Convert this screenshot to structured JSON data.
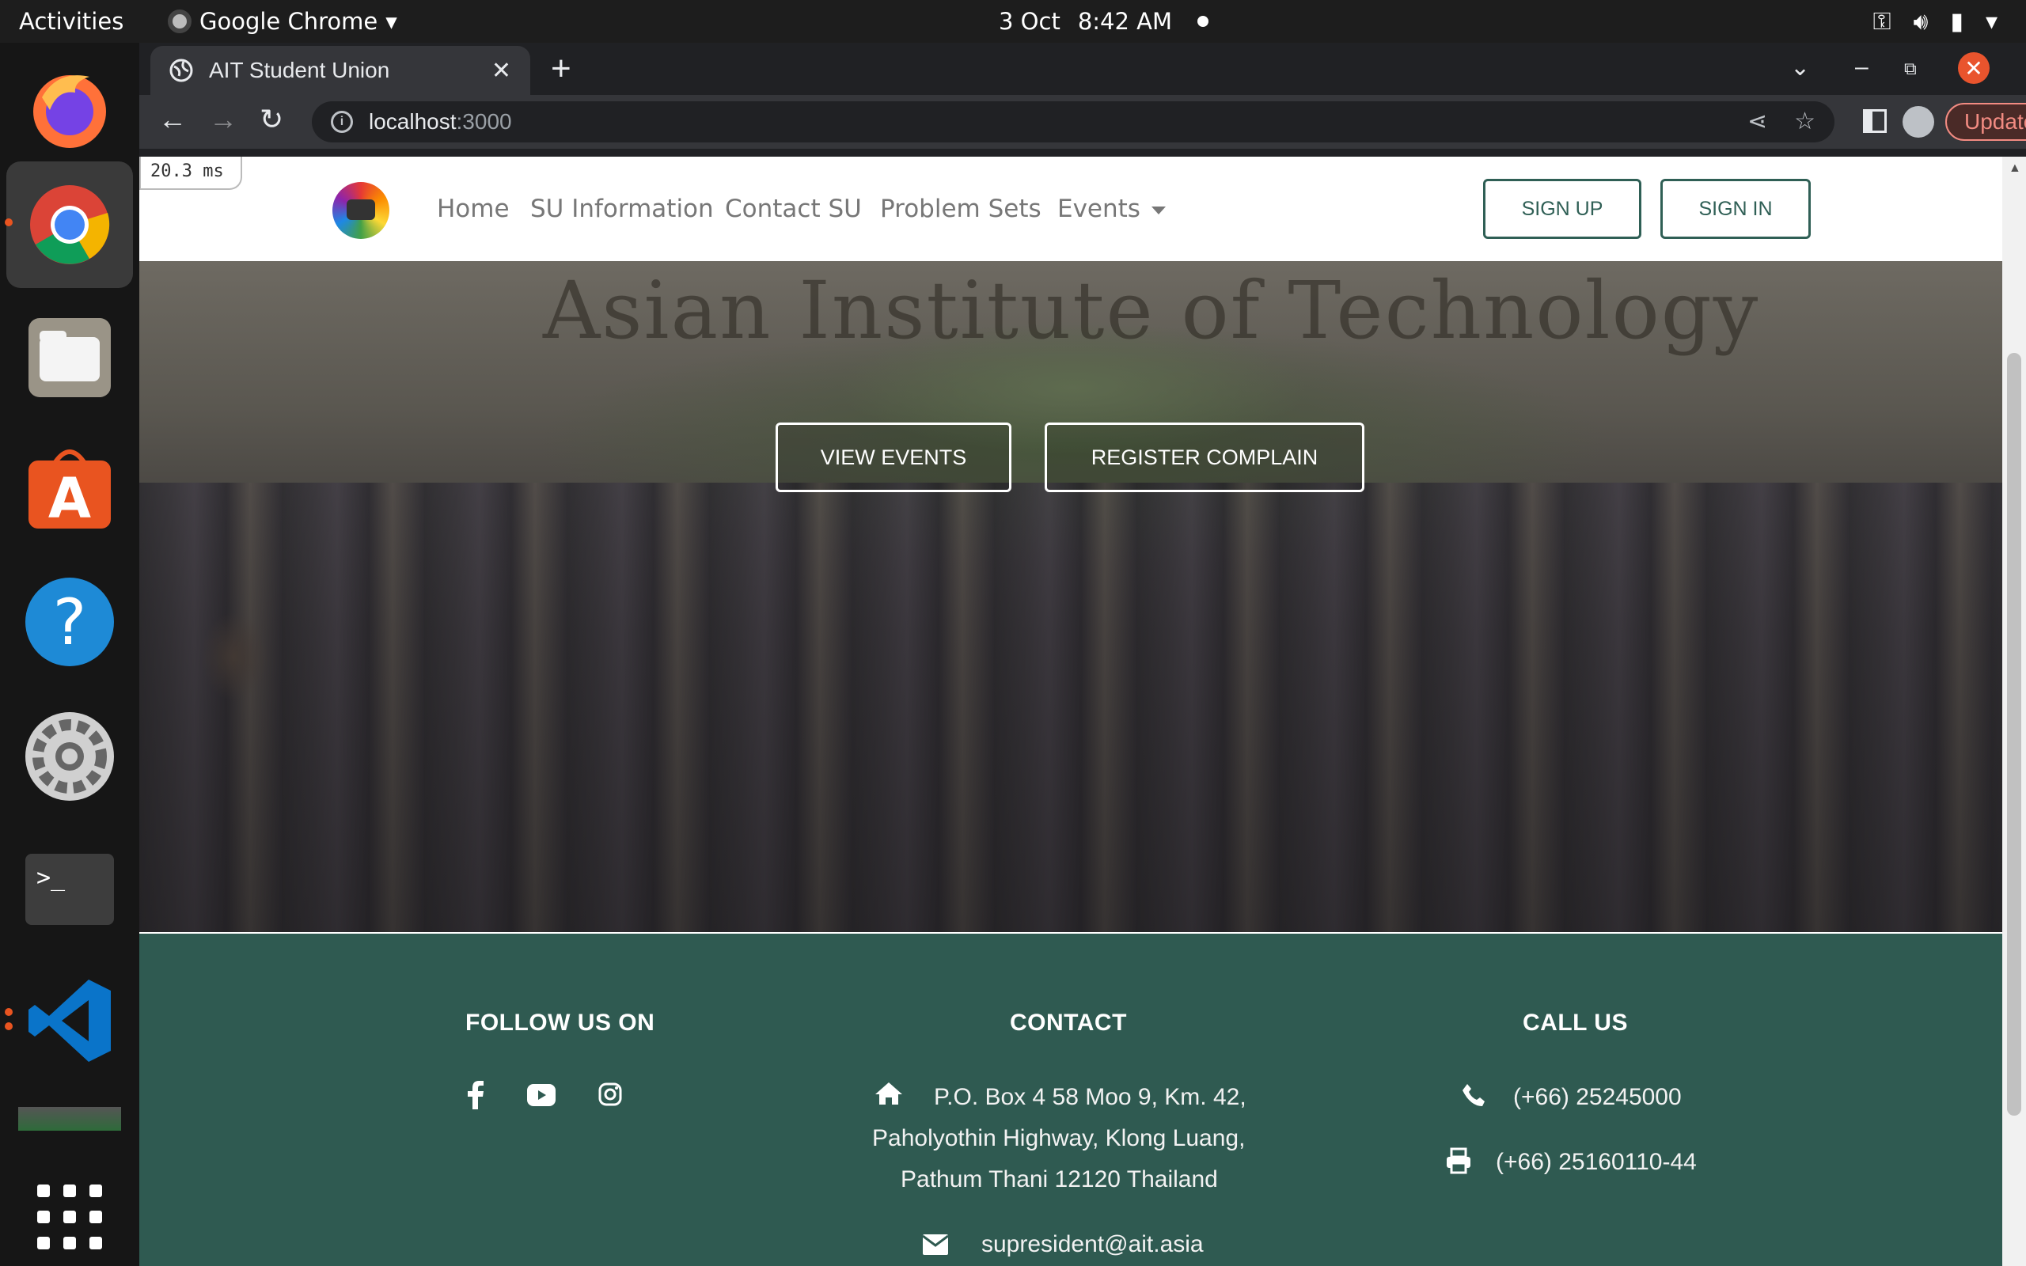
{
  "os_bar": {
    "activities": "Activities",
    "app_name": "Google Chrome",
    "date": "3 Oct",
    "time": "8:42 AM"
  },
  "dock": {
    "items": [
      "firefox-icon",
      "chrome-icon",
      "files-icon",
      "app-center-icon",
      "help-icon",
      "settings-icon",
      "terminal-icon",
      "vscode-icon",
      "show-apps-icon"
    ]
  },
  "browser": {
    "tab_title": "AIT Student Union",
    "url_host": "localhost",
    "url_port": ":3000",
    "update_label": "Update"
  },
  "site": {
    "perf_badge": "20.3 ms",
    "nav": {
      "home": "Home",
      "su_info": "SU Information",
      "contact": "Contact SU",
      "problems": "Problem Sets",
      "events": "Events"
    },
    "sign_up": "SIGN UP",
    "sign_in": "SIGN IN",
    "hero": {
      "sign_text": "Asian Institute of Technology",
      "view_events": "VIEW EVENTS",
      "register_complain": "REGISTER COMPLAIN"
    },
    "footer": {
      "follow_heading": "FOLLOW US ON",
      "contact_heading": "CONTACT",
      "call_heading": "CALL US",
      "address_line1": "P.O. Box 4 58 Moo 9, Km. 42,",
      "address_line2": "Paholyothin Highway, Klong Luang,",
      "address_line3": "Pathum Thani 12120 Thailand",
      "email": "supresident@ait.asia",
      "phone": "(+66) 25245000",
      "fax": "(+66) 25160110-44"
    }
  },
  "colors": {
    "footer_bg": "#2f5a51",
    "brand_green": "#2f5f55",
    "update_accent": "#f28b82"
  }
}
